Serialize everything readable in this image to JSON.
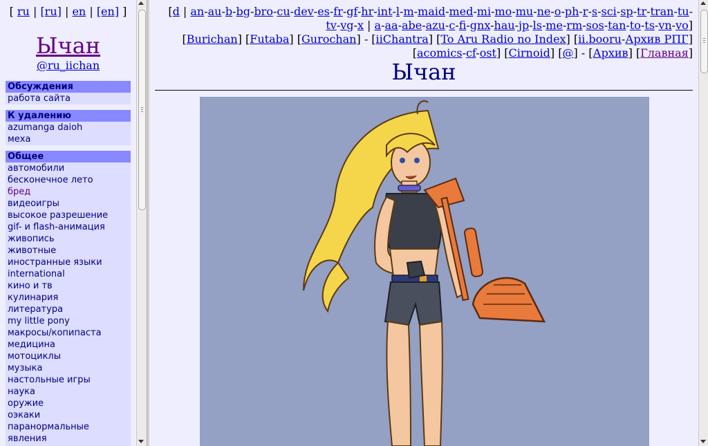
{
  "left_panel": {
    "lang_links": {
      "open1": "[",
      "ru": "ru",
      "sep1": "|",
      "ru_bracket": "[ru]",
      "sep2": "|",
      "en": "en",
      "sep3": "|",
      "en_bracket": "[en]",
      "close1": "]"
    },
    "logo": "Ычан",
    "handle": "@ru_iichan",
    "sections": [
      {
        "header": "Обсуждения",
        "items": [
          {
            "label": "работа сайта"
          }
        ]
      },
      {
        "header": "К удалению",
        "items": [
          {
            "label": "azumanga daioh"
          },
          {
            "label": "меха"
          }
        ]
      },
      {
        "header": "Общее",
        "items": [
          {
            "label": "автомобили"
          },
          {
            "label": "бесконечное лето"
          },
          {
            "label": "бред"
          },
          {
            "label": "видеоигры"
          },
          {
            "label": "высокое разрешение"
          },
          {
            "label": "gif- и flash-анимация"
          },
          {
            "label": "живопись"
          },
          {
            "label": "животные"
          },
          {
            "label": "иностранные языки"
          },
          {
            "label": "international"
          },
          {
            "label": "кино и тв"
          },
          {
            "label": "кулинария"
          },
          {
            "label": "литература"
          },
          {
            "label": "my little pony"
          },
          {
            "label": "макросы/копипаста"
          },
          {
            "label": "медицина"
          },
          {
            "label": "мотоциклы"
          },
          {
            "label": "музыка"
          },
          {
            "label": "настольные игры"
          },
          {
            "label": "наука"
          },
          {
            "label": "оружие"
          },
          {
            "label": "оэкаки"
          },
          {
            "label": "паранормальные"
          },
          {
            "label": "явления"
          }
        ]
      }
    ]
  },
  "nav": {
    "line1_boards": [
      "d",
      "an",
      "au",
      "b",
      "bg",
      "bro",
      "cu",
      "dev",
      "es",
      "fr",
      "gf",
      "hr",
      "int",
      "l",
      "m",
      "maid",
      "med",
      "mi",
      "mo",
      "mu",
      "ne",
      "o",
      "ph",
      "r",
      "s",
      "sci",
      "sp",
      "tr",
      "tran",
      "tu"
    ],
    "line2_boards_a": [
      "tv",
      "vg",
      "x"
    ],
    "line2_boards_b": [
      "a",
      "aa",
      "abe",
      "azu",
      "c",
      "fi",
      "gnx",
      "hau",
      "jp",
      "ls",
      "me",
      "rm",
      "sos",
      "tan",
      "to",
      "ts",
      "vn",
      "vo"
    ],
    "line3_links": [
      "Burichan",
      "Futaba",
      "Gurochan"
    ],
    "line3_links_b": [
      "iiChantra",
      "To Aru Radio no Index"
    ],
    "line3_booru": [
      "ii.booru",
      "Архив РПГ"
    ],
    "line4_links": [
      "acomics",
      "cf",
      "ost"
    ],
    "cirnoid": "Cirnoid",
    "at": "@",
    "archive": "Архив",
    "home": "Главная"
  },
  "main": {
    "title": "Ычан",
    "image_alt": "board banner artwork"
  },
  "colors": {
    "menu_header_bg": "#8888ff",
    "menu_bg": "#ddddff",
    "page_bg": "#eeeeff",
    "title": "#000080",
    "link": "#0000cc",
    "visited": "#660088",
    "art_bg": "#94a0c4"
  }
}
